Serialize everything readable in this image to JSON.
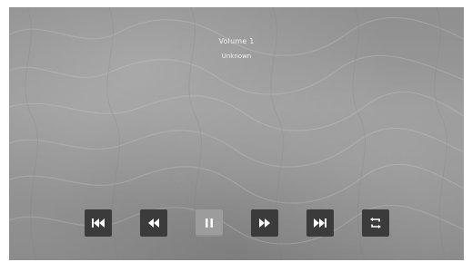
{
  "player": {
    "title": "Volume 1",
    "artist": "Unknown"
  },
  "controls": [
    {
      "name": "skip-previous-button",
      "icon": "skip-previous-icon"
    },
    {
      "name": "rewind-button",
      "icon": "rewind-icon"
    },
    {
      "name": "pause-button",
      "icon": "pause-icon",
      "active": true
    },
    {
      "name": "fast-forward-button",
      "icon": "fast-forward-icon"
    },
    {
      "name": "skip-next-button",
      "icon": "skip-next-icon"
    },
    {
      "name": "repeat-button",
      "icon": "repeat-icon"
    }
  ],
  "colors": {
    "button_bg": "#3b3b3b",
    "button_active_bg": "#9c9c9c",
    "icon_fill": "#ffffff"
  }
}
